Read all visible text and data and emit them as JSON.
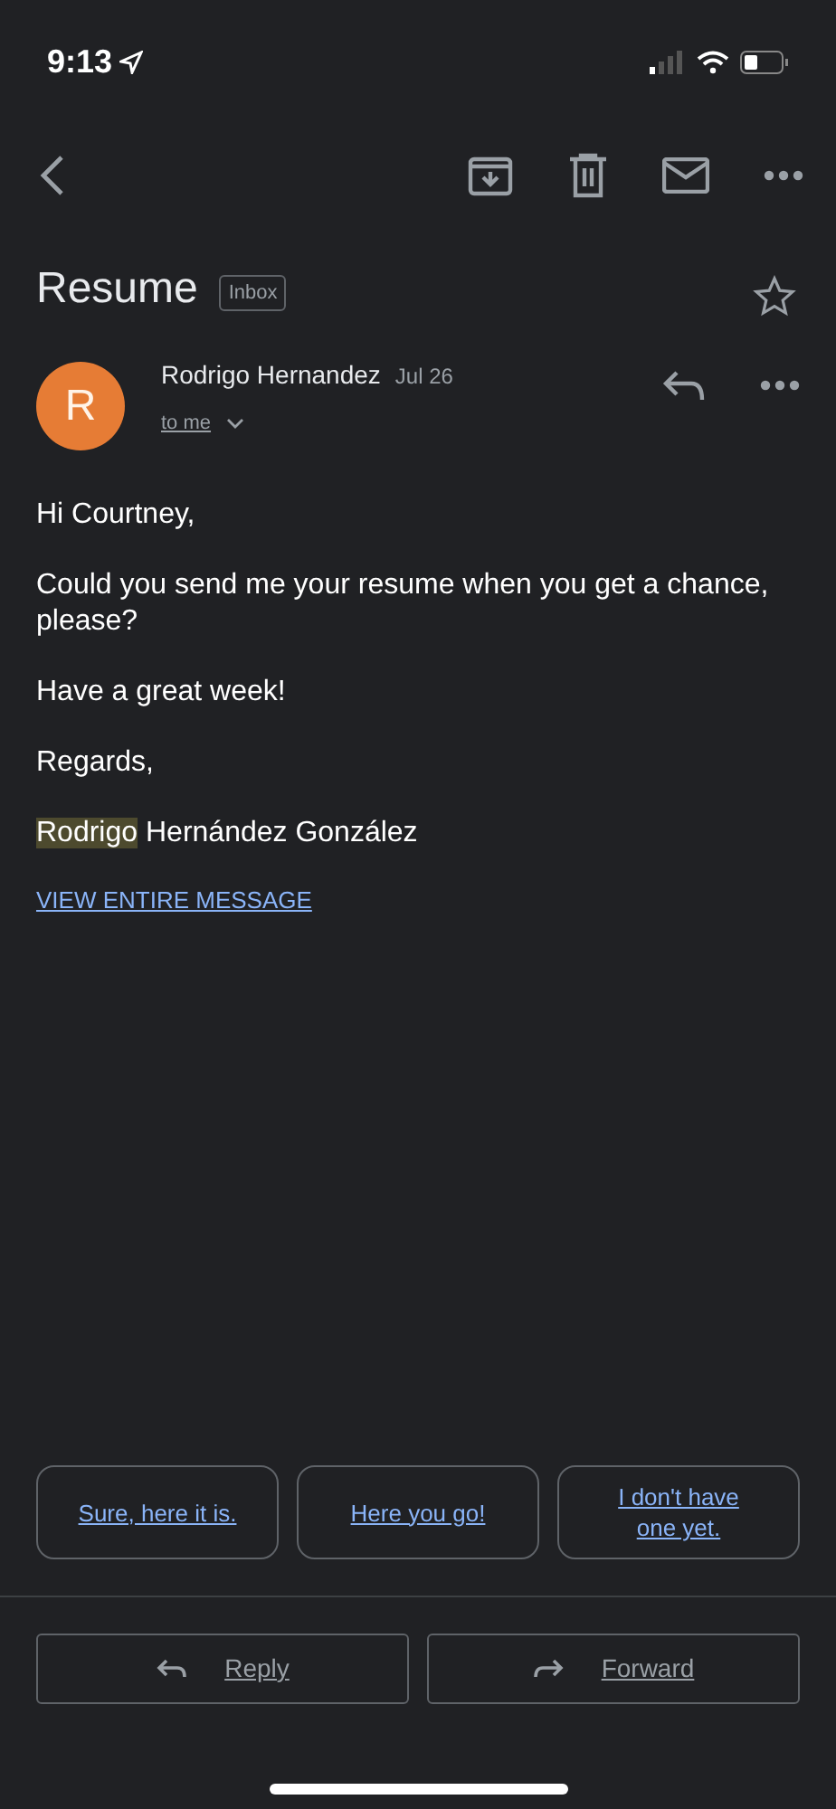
{
  "status_bar": {
    "time": "9:13"
  },
  "message": {
    "subject": "Resume",
    "label": "Inbox",
    "starred": false,
    "sender": "Rodrigo Hernandez",
    "avatar_letter": "R",
    "date": "Jul 26",
    "recipient": "to me",
    "paragraphs": [
      "Hi Courtney,",
      "Could you send me your resume when you get a chance, please?",
      "Have a great week!",
      "Regards,"
    ],
    "signature": {
      "highlighted": "Rodrigo",
      "rest": "Hernández González"
    },
    "view_entire": "VIEW ENTIRE MESSAGE"
  },
  "smart_replies": [
    "Sure, here it is.",
    "Here you go!",
    "I don't have one yet."
  ],
  "actions": [
    {
      "kind": "reply",
      "label": "Reply"
    },
    {
      "kind": "forward",
      "label": "Forward"
    }
  ]
}
